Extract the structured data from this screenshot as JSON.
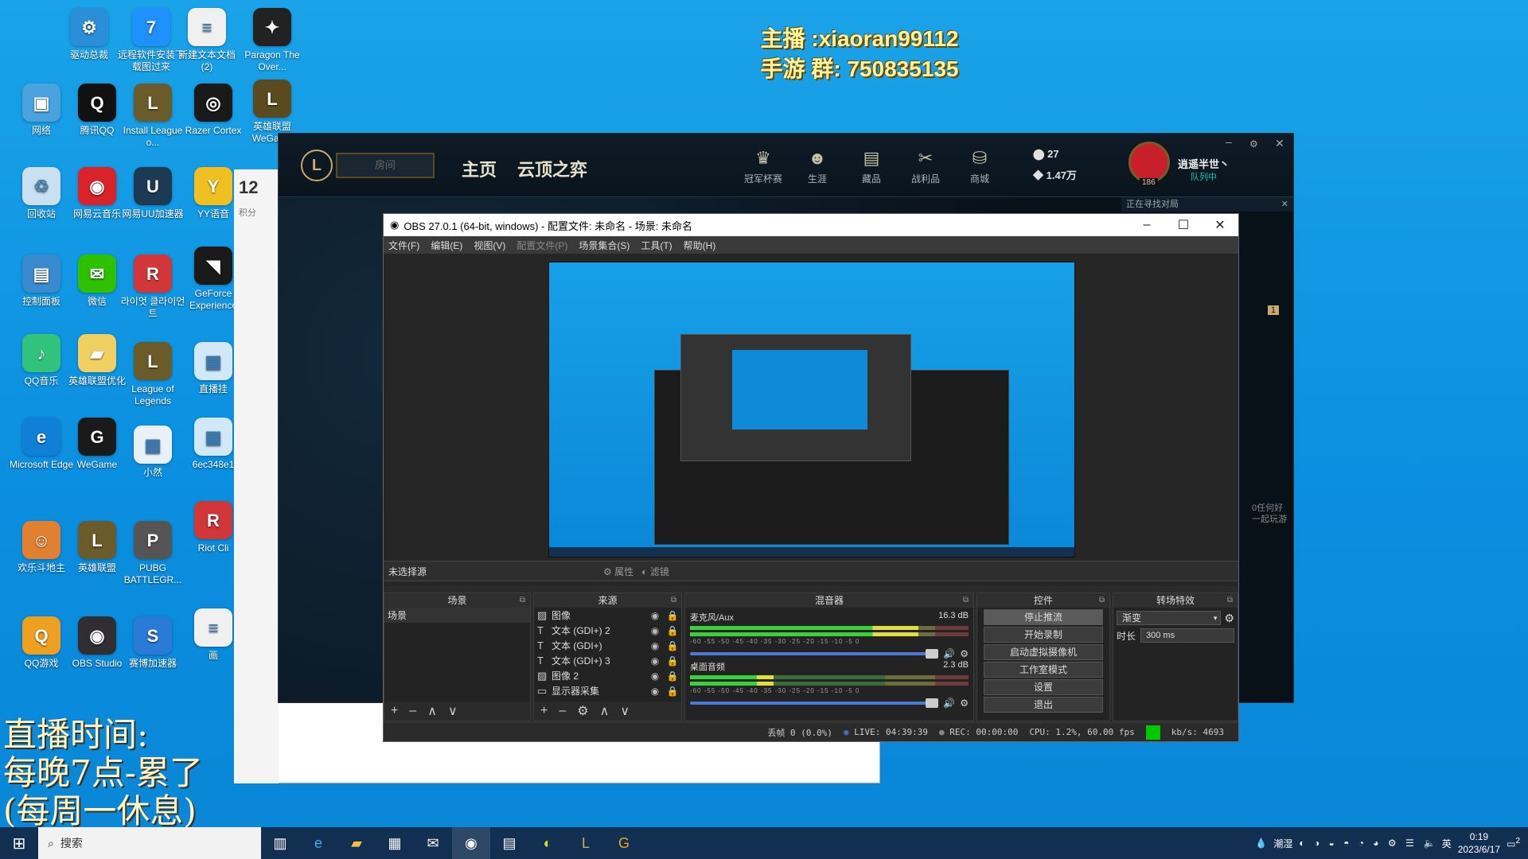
{
  "overlay": {
    "line1": "主播  :xiaoran99112",
    "line2": "手游  群:  750835135",
    "live_title": "直播时间:",
    "live_line2": "每晚7点-累了",
    "live_line3": "(每周一休息)"
  },
  "desktop_icons": [
    {
      "label": "驱动总裁",
      "color": "#2a8fd8",
      "glyph": "⚙"
    },
    {
      "label": "远程软件安装下载图过来",
      "color": "#1e90ff",
      "glyph": "7"
    },
    {
      "label": "新建文本文档 (2)",
      "color": "#f0f0f0",
      "glyph": "≡"
    },
    {
      "label": "Paragon The Over...",
      "color": "#222",
      "glyph": "✦"
    },
    {
      "label": "网络",
      "color": "#4aa3df",
      "glyph": "▣"
    },
    {
      "label": "腾讯QQ",
      "color": "#111",
      "glyph": "Q"
    },
    {
      "label": "Install League o...",
      "color": "#6b5a2a",
      "glyph": "L"
    },
    {
      "label": "Razer Cortex",
      "color": "#1a1a1a",
      "glyph": "◎"
    },
    {
      "label": "英雄联盟WeGame",
      "color": "#5a4a20",
      "glyph": "L"
    },
    {
      "label": "回收站",
      "color": "#c8e0f0",
      "glyph": "♲"
    },
    {
      "label": "网易云音乐",
      "color": "#d8232a",
      "glyph": "◉"
    },
    {
      "label": "网易UU加速器",
      "color": "#1d3a55",
      "glyph": "U"
    },
    {
      "label": "YY语音",
      "color": "#f0c020",
      "glyph": "Y"
    },
    {
      "label": "控制面板",
      "color": "#3a8ad0",
      "glyph": "▤"
    },
    {
      "label": "微信",
      "color": "#2dc100",
      "glyph": "✉"
    },
    {
      "label": "라이엇 클라이언트",
      "color": "#d13639",
      "glyph": "R"
    },
    {
      "label": "GeForce Experience",
      "color": "#1a1a1a",
      "glyph": "◥"
    },
    {
      "label": "QQ音乐",
      "color": "#31c27c",
      "glyph": "♪"
    },
    {
      "label": "英雄联盟优化",
      "color": "#f0d060",
      "glyph": "▰"
    },
    {
      "label": "League of Legends",
      "color": "#6b5a2a",
      "glyph": "L"
    },
    {
      "label": "直播挂",
      "color": "#d0e8f8",
      "glyph": "▦"
    },
    {
      "label": "Microsoft Edge",
      "color": "#0f7fd8",
      "glyph": "e"
    },
    {
      "label": "WeGame",
      "color": "#1a1a1a",
      "glyph": "G"
    },
    {
      "label": "小然",
      "color": "#e8f0f8",
      "glyph": "▦"
    },
    {
      "label": "6ec348e1",
      "color": "#d0e8f8",
      "glyph": "▦"
    },
    {
      "label": "欢乐斗地主",
      "color": "#e08030",
      "glyph": "☺"
    },
    {
      "label": "英雄联盟",
      "color": "#6b5a2a",
      "glyph": "L"
    },
    {
      "label": "PUBG BATTLEGR...",
      "color": "#555",
      "glyph": "P"
    },
    {
      "label": "Riot Cli",
      "color": "#d13639",
      "glyph": "R"
    },
    {
      "label": "QQ游戏",
      "color": "#f0a020",
      "glyph": "Q"
    },
    {
      "label": "OBS Studio",
      "color": "#302e31",
      "glyph": "◉"
    },
    {
      "label": "赛博加速器",
      "color": "#2a7ad8",
      "glyph": "S"
    },
    {
      "label": "画",
      "color": "#f0f0f0",
      "glyph": "≡"
    }
  ],
  "lol": {
    "nav_home": "主页",
    "nav_tft": "云顶之弈",
    "play_placeholder": "房间",
    "icons": [
      {
        "label": "冠军杯赛",
        "glyph": "♛"
      },
      {
        "label": "生涯",
        "glyph": "☻"
      },
      {
        "label": "藏品",
        "glyph": "▤"
      },
      {
        "label": "战利品",
        "glyph": "✂"
      },
      {
        "label": "商城",
        "glyph": "⛁"
      }
    ],
    "rp": "27",
    "be": "1.47万",
    "username": "逍遥半世丶",
    "status": "队列中",
    "level": "186",
    "queue_text": "正在寻找对局",
    "friend_hint": "0任何好一起玩游",
    "side_points": "12",
    "side_points_label": "积分",
    "badge": "1"
  },
  "obs": {
    "title": "OBS 27.0.1 (64-bit, windows) - 配置文件: 未命名 - 场景: 未命名",
    "menu": [
      "文件(F)",
      "编辑(E)",
      "视图(V)",
      "配置文件(P)",
      "场景集合(S)",
      "工具(T)",
      "帮助(H)"
    ],
    "no_source": "未选择源",
    "properties": "属性",
    "filters": "滤镜",
    "docks": {
      "scenes": "场景",
      "sources": "来源",
      "mixer": "混音器",
      "controls": "控件",
      "transitions": "转场特效"
    },
    "scene_items": [
      "场景"
    ],
    "sources": [
      {
        "icon": "image-icon",
        "glyph": "▨",
        "name": "图像"
      },
      {
        "icon": "text-icon",
        "glyph": "T",
        "name": "文本 (GDI+) 2"
      },
      {
        "icon": "text-icon",
        "glyph": "T",
        "name": "文本 (GDI+)"
      },
      {
        "icon": "text-icon",
        "glyph": "T",
        "name": "文本 (GDI+) 3"
      },
      {
        "icon": "image-icon",
        "glyph": "▨",
        "name": "图像 2"
      },
      {
        "icon": "display-icon",
        "glyph": "▭",
        "name": "显示器采集"
      }
    ],
    "mixer": [
      {
        "name": "麦克风/Aux",
        "db": "16.3 dB",
        "level": 0.82
      },
      {
        "name": "桌面音频",
        "db": "2.3 dB",
        "level": 0.3
      }
    ],
    "meter_scale": "-60 -55 -50 -45 -40 -35 -30 -25 -20 -15 -10 -5 0",
    "controls": [
      "停止推流",
      "开始录制",
      "启动虚拟摄像机",
      "工作室模式",
      "设置",
      "退出"
    ],
    "transition": {
      "value": "渐变",
      "duration_label": "时长",
      "duration": "300 ms"
    },
    "status": {
      "dropped": "丢帧 0 (0.0%)",
      "live": "LIVE: 04:39:39",
      "rec": "REC: 00:00:00",
      "cpu": "CPU: 1.2%, 60.00 fps",
      "kbs": "kb/s: 4693"
    }
  },
  "taskbar": {
    "search_placeholder": "搜索",
    "weather": "潮湿",
    "ime": "英",
    "time": "0:19",
    "date": "2023/6/17",
    "notification_count": "2"
  },
  "colors": {
    "obs_bg": "#2b2b2b",
    "live_green": "#00c800",
    "desktop_blue": "#0b8fe0"
  }
}
